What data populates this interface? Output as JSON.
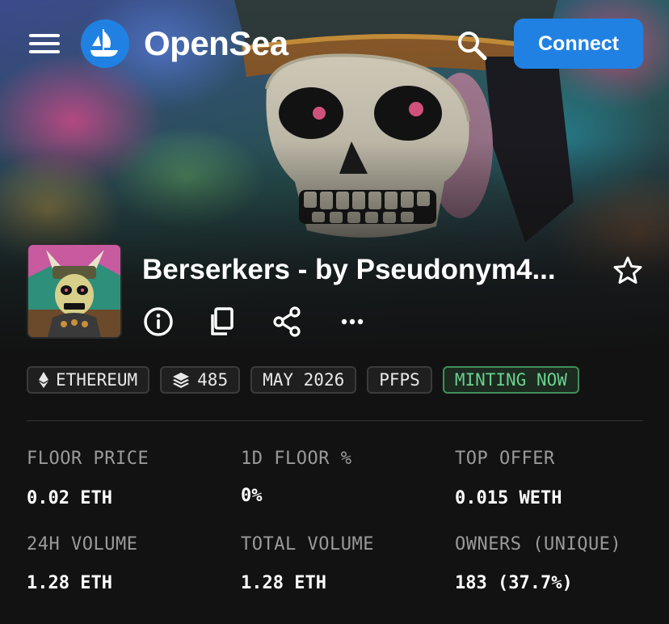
{
  "brand": {
    "name": "OpenSea",
    "accent": "#2081e2"
  },
  "nav": {
    "menu_icon": "hamburger-icon",
    "search_icon": "search-icon",
    "connect_label": "Connect"
  },
  "collection": {
    "title": "Berserkers - by Pseudonym4...",
    "favorite_icon": "star-icon",
    "actions": [
      {
        "icon": "info-icon"
      },
      {
        "icon": "copy-icon"
      },
      {
        "icon": "share-icon"
      },
      {
        "icon": "more-icon"
      }
    ]
  },
  "chips": {
    "chain": "ETHEREUM",
    "items": "485",
    "date": "MAY 2026",
    "category": "PFPS",
    "status": "MINTING NOW",
    "status_color": "#6bd08e"
  },
  "stats": {
    "floor_price": {
      "label": "FLOOR PRICE",
      "value": "0.02 ETH"
    },
    "floor_change": {
      "label": "1D FLOOR %",
      "value": "0%"
    },
    "top_offer": {
      "label": "TOP OFFER",
      "value": "0.015 WETH"
    },
    "volume_24h": {
      "label": "24H VOLUME",
      "value": "1.28 ETH"
    },
    "total_volume": {
      "label": "TOTAL VOLUME",
      "value": "1.28 ETH"
    },
    "owners": {
      "label": "OWNERS (UNIQUE)",
      "value": "183 (37.7%)"
    }
  }
}
